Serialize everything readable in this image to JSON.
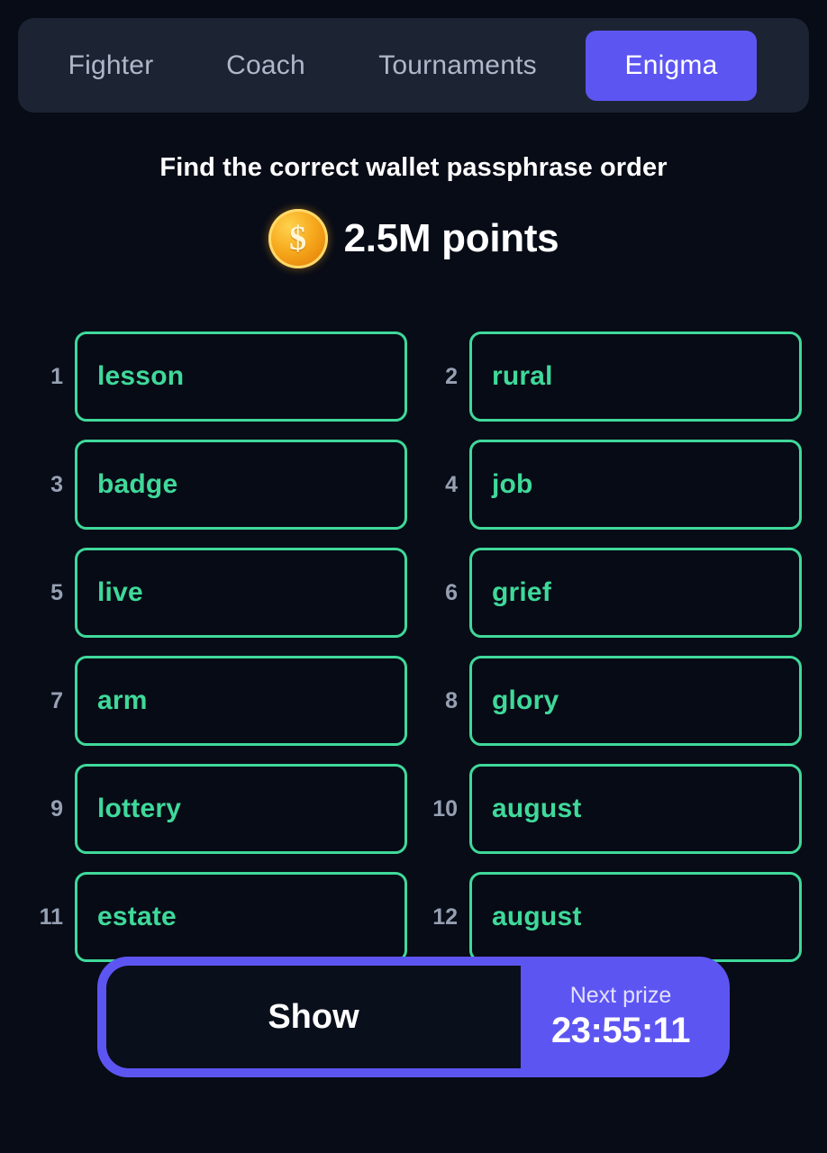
{
  "nav": {
    "tabs": [
      {
        "label": "Fighter",
        "active": false
      },
      {
        "label": "Coach",
        "active": false
      },
      {
        "label": "Tournaments",
        "active": false
      },
      {
        "label": "Enigma",
        "active": true
      }
    ]
  },
  "header": {
    "title": "Find the correct wallet passphrase order",
    "coin_icon": "coin-icon",
    "coin_symbol": "$",
    "points": "2.5M points"
  },
  "passphrase": {
    "words": [
      {
        "index": "1",
        "word": "lesson"
      },
      {
        "index": "2",
        "word": "rural"
      },
      {
        "index": "3",
        "word": "badge"
      },
      {
        "index": "4",
        "word": "job"
      },
      {
        "index": "5",
        "word": "live"
      },
      {
        "index": "6",
        "word": "grief"
      },
      {
        "index": "7",
        "word": "arm"
      },
      {
        "index": "8",
        "word": "glory"
      },
      {
        "index": "9",
        "word": "lottery"
      },
      {
        "index": "10",
        "word": "august"
      },
      {
        "index": "11",
        "word": "estate"
      },
      {
        "index": "12",
        "word": "august"
      }
    ]
  },
  "footer": {
    "show_label": "Show",
    "prize_label": "Next prize",
    "prize_timer": "23:55:11"
  },
  "colors": {
    "page_bg": "#080c17",
    "navbar_bg": "#1c2433",
    "accent_purple": "#5d55f2",
    "word_green": "#3fd99a",
    "coin_gold": "#f6a81c",
    "tab_inactive": "#aeb8c9",
    "index_gray": "#96a0b3"
  }
}
